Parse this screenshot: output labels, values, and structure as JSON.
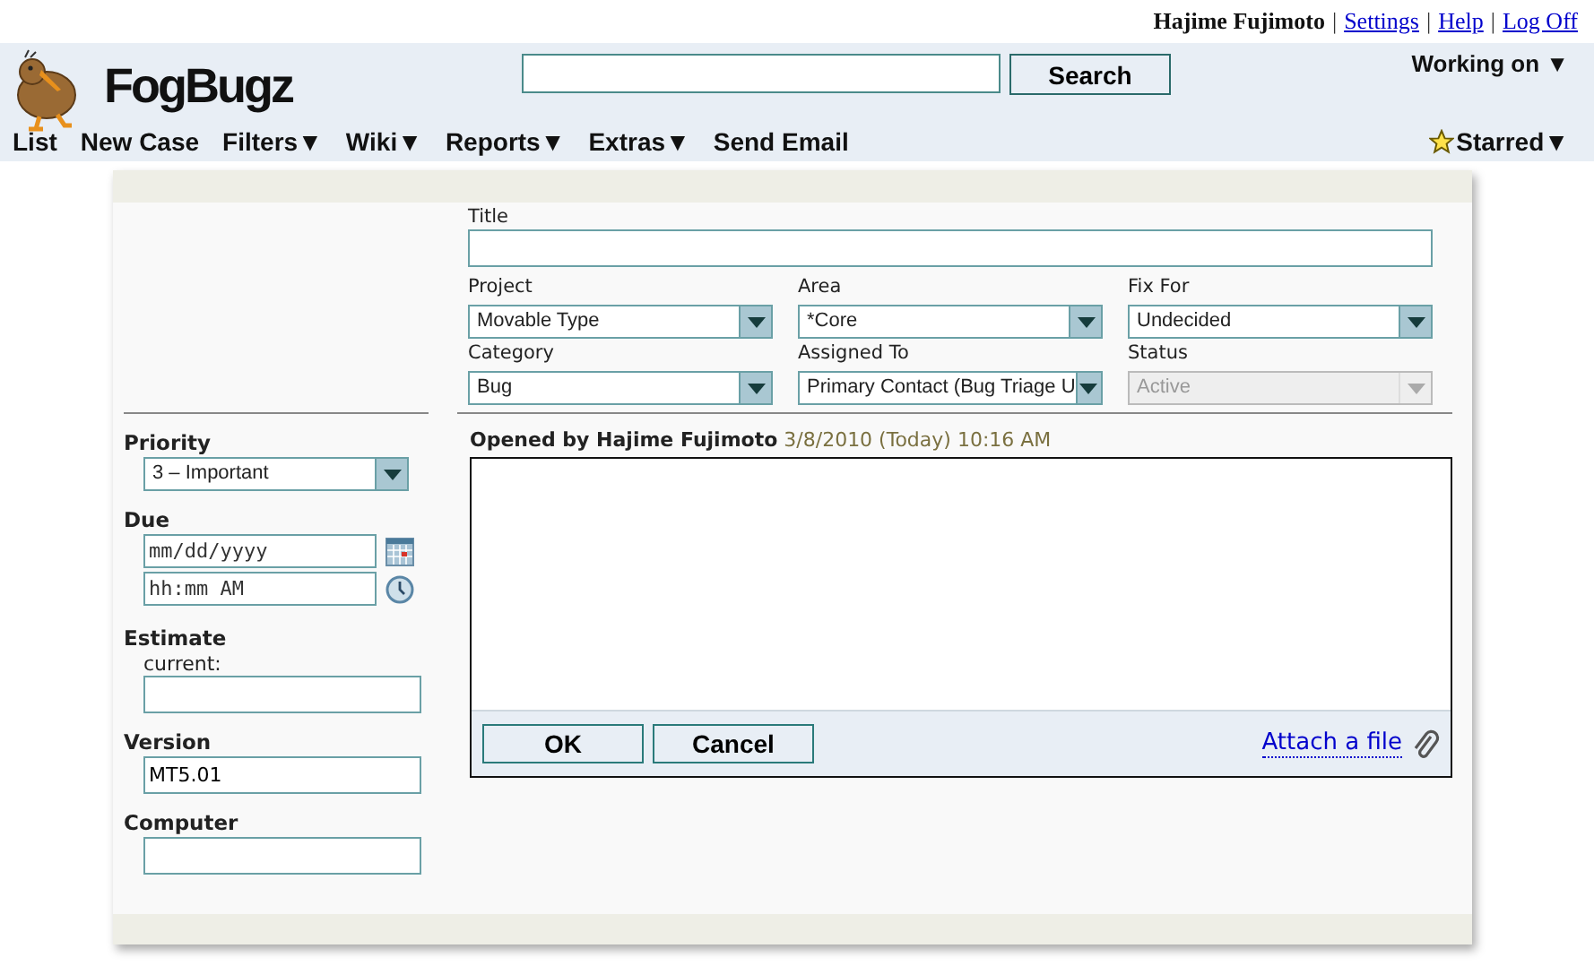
{
  "user_bar": {
    "user": "Hajime Fujimoto",
    "separator": "|",
    "links": [
      "Settings",
      "Help",
      "Log Off"
    ]
  },
  "header": {
    "logo": "FogBugz",
    "search": {
      "button": "Search"
    },
    "working_on": "Working on ▼"
  },
  "nav": {
    "items": [
      "List",
      "New Case",
      "Filters▼",
      "Wiki▼",
      "Reports▼",
      "Extras▼",
      "Send Email"
    ],
    "starred": "Starred▼"
  },
  "case": {
    "title_label": "Title",
    "fields": [
      {
        "label": "Project",
        "value": "Movable Type",
        "disabled": false
      },
      {
        "label": "Area",
        "value": "*Core",
        "disabled": false
      },
      {
        "label": "Fix For",
        "value": "Undecided",
        "disabled": false
      },
      {
        "label": "Category",
        "value": "Bug",
        "disabled": false
      },
      {
        "label": "Assigned To",
        "value": "Primary Contact (Bug Triage U",
        "disabled": false
      },
      {
        "label": "Status",
        "value": "Active",
        "disabled": true
      }
    ],
    "priority": {
      "label": "Priority",
      "value": "3 – Important"
    },
    "due": {
      "label": "Due",
      "date_placeholder": "mm/dd/yyyy",
      "time_placeholder": "hh:mm AM"
    },
    "estimate": {
      "label": "Estimate",
      "sublabel": "current:"
    },
    "version": {
      "label": "Version",
      "value": "MT5.01"
    },
    "computer": {
      "label": "Computer"
    },
    "opened": {
      "by": "Opened by Hajime Fujimoto",
      "when": "3/8/2010 (Today) 10:16 AM"
    },
    "buttons": [
      "OK",
      "Cancel"
    ],
    "attach": "Attach a file"
  }
}
